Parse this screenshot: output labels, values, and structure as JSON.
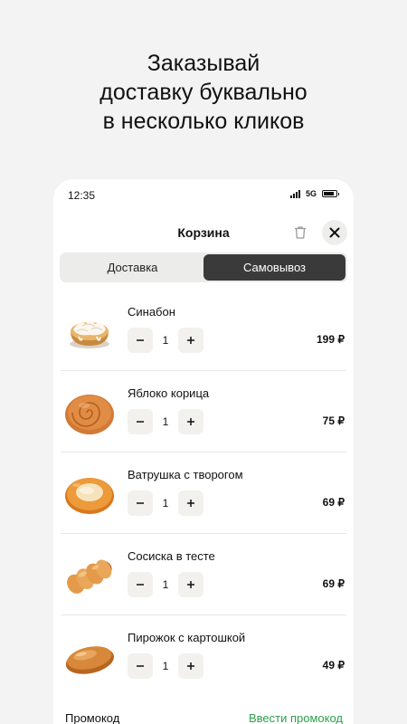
{
  "headline": {
    "line1": "Заказывай",
    "line2": "доставку буквально",
    "line3": "в несколько кликов"
  },
  "statusbar": {
    "time": "12:35",
    "network": "5G"
  },
  "header": {
    "title": "Корзина"
  },
  "tabs": [
    {
      "label": "Доставка",
      "active": false
    },
    {
      "label": "Самовывоз",
      "active": true
    }
  ],
  "items": [
    {
      "name": "Синабон",
      "quantity": "1",
      "price": "199 ₽",
      "image": "cinnabon"
    },
    {
      "name": "Яблоко корица",
      "quantity": "1",
      "price": "75 ₽",
      "image": "apple-cinnamon-bun"
    },
    {
      "name": "Ватрушка с творогом",
      "quantity": "1",
      "price": "69 ₽",
      "image": "vatrushka"
    },
    {
      "name": "Сосиска в тесте",
      "quantity": "1",
      "price": "69 ₽",
      "image": "sausage-roll"
    },
    {
      "name": "Пирожок с картошкой",
      "quantity": "1",
      "price": "49 ₽",
      "image": "potato-pie"
    }
  ],
  "promo": {
    "label": "Промокод",
    "link": "Ввести промокод"
  },
  "colors": {
    "background": "#f3f3f3",
    "active_tab": "#3a3a3a",
    "promo_link": "#2e9e4e"
  }
}
